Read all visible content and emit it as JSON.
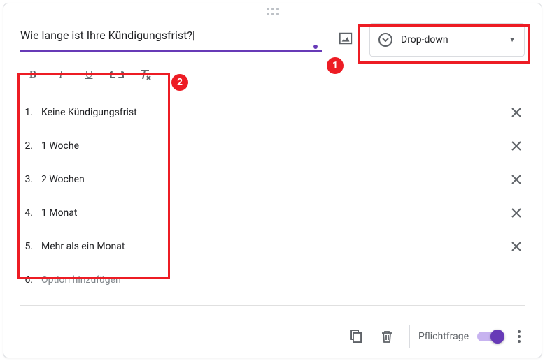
{
  "question": {
    "text": "Wie lange ist Ihre Kündigungsfrist?"
  },
  "questionType": {
    "label": "Drop-down"
  },
  "options": [
    {
      "num": "1.",
      "text": "Keine Kündigungsfrist",
      "removable": true
    },
    {
      "num": "2.",
      "text": "1 Woche",
      "removable": true
    },
    {
      "num": "3.",
      "text": "2 Wochen",
      "removable": true
    },
    {
      "num": "4.",
      "text": "1 Monat",
      "removable": true
    },
    {
      "num": "5.",
      "text": "Mehr als ein Monat",
      "removable": true
    },
    {
      "num": "6.",
      "text": "Option hinzufügen",
      "removable": false
    }
  ],
  "footer": {
    "requiredLabel": "Pflichtfrage"
  },
  "callouts": {
    "badge1": "1",
    "badge2": "2"
  }
}
